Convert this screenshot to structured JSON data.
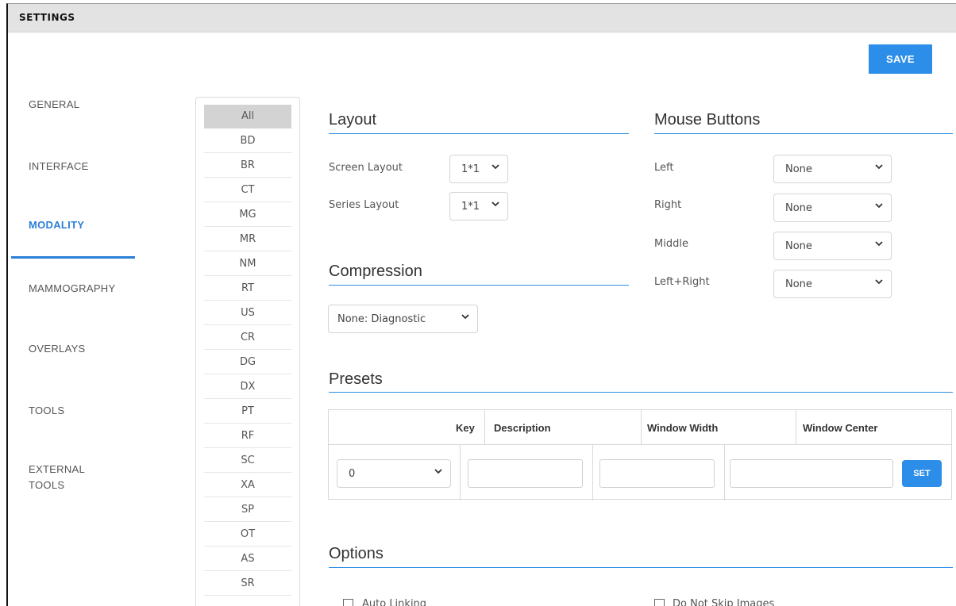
{
  "window": {
    "title": "SETTINGS"
  },
  "toolbar": {
    "save_label": "SAVE"
  },
  "sidebar": {
    "items": [
      {
        "label": "GENERAL"
      },
      {
        "label": "INTERFACE"
      },
      {
        "label": "MODALITY",
        "active": true
      },
      {
        "label": "MAMMOGRAPHY"
      },
      {
        "label": "OVERLAYS"
      },
      {
        "label": "TOOLS"
      },
      {
        "label": "EXTERNAL"
      },
      {
        "label": "TOOLS"
      }
    ]
  },
  "modalities": [
    "All",
    "BD",
    "BR",
    "CT",
    "MG",
    "MR",
    "NM",
    "RT",
    "US",
    "CR",
    "DG",
    "DX",
    "PT",
    "RF",
    "SC",
    "XA",
    "SP",
    "OT",
    "AS",
    "SR"
  ],
  "selected_modality": "All",
  "layout": {
    "title": "Layout",
    "screen_label": "Screen Layout",
    "screen_value": "1*1",
    "series_label": "Series Layout",
    "series_value": "1*1"
  },
  "compression": {
    "title": "Compression",
    "value": "None: Diagnostic"
  },
  "mouse_buttons": {
    "title": "Mouse Buttons",
    "rows": [
      {
        "label": "Left",
        "value": "None"
      },
      {
        "label": "Right",
        "value": "None"
      },
      {
        "label": "Middle",
        "value": "None"
      },
      {
        "label": "Left+Right",
        "value": "None"
      }
    ]
  },
  "presets": {
    "title": "Presets",
    "columns": [
      "Key",
      "Description",
      "Window Width",
      "Window Center"
    ],
    "key_value": "0",
    "set_label": "SET"
  },
  "options": {
    "title": "Options",
    "items": [
      {
        "label": "Auto Linking",
        "checked": false
      },
      {
        "label": "Do Not Skip Images",
        "checked": false
      }
    ]
  },
  "colors": {
    "accent": "#2c8ee8",
    "active_nav": "#2c7fd6",
    "selected_row": "#d3d3d3"
  }
}
